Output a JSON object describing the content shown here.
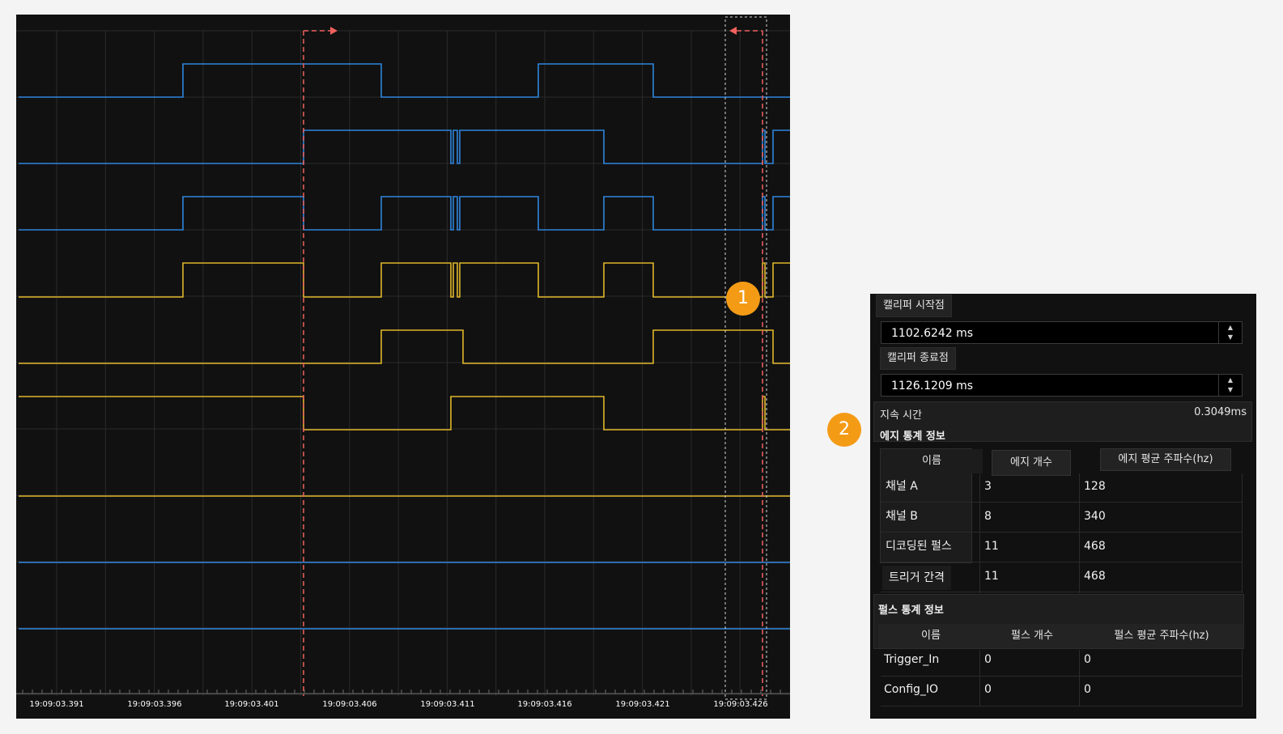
{
  "scope": {
    "time_labels": [
      "19:09:03.391",
      "19:09:03.396",
      "19:09:03.401",
      "19:09:03.406",
      "19:09:03.411",
      "19:09:03.416",
      "19:09:03.421",
      "19:09:03.426"
    ],
    "colors": {
      "blue": "#2f86dd",
      "yellow": "#e0b62a",
      "cursor": "#f0625e",
      "grid": "#2b2b2b"
    }
  },
  "badges": {
    "one": "1",
    "two": "2"
  },
  "panel": {
    "caliper_start_label": "캘리퍼 시작점",
    "caliper_start_value": "1102.6242 ms",
    "caliper_end_label": "캘리퍼 종료점",
    "caliper_end_value": "1126.1209 ms",
    "duration_label": "지속 시간",
    "duration_value": "0.3049ms",
    "edge_stats_title": "에지 통계 정보",
    "edge_table": {
      "headers": [
        "이름",
        "에지 개수",
        "에지 평균 주파수(hz)"
      ],
      "rows": [
        {
          "name": "채널 A",
          "count": "3",
          "freq": "128"
        },
        {
          "name": "채널 B",
          "count": "8",
          "freq": "340"
        },
        {
          "name": "디코딩된 펄스",
          "count": "11",
          "freq": "468"
        },
        {
          "name": "트리거 간격",
          "count": "11",
          "freq": "468"
        }
      ]
    },
    "pulse_stats_title": "펄스 통계 정보",
    "pulse_table": {
      "headers": [
        "이름",
        "펄스 개수",
        "펄스 평균 주파수(hz)"
      ],
      "rows": [
        {
          "name": "Trigger_In",
          "count": "0",
          "freq": "0"
        },
        {
          "name": "Config_IO",
          "count": "0",
          "freq": "0"
        }
      ]
    }
  }
}
